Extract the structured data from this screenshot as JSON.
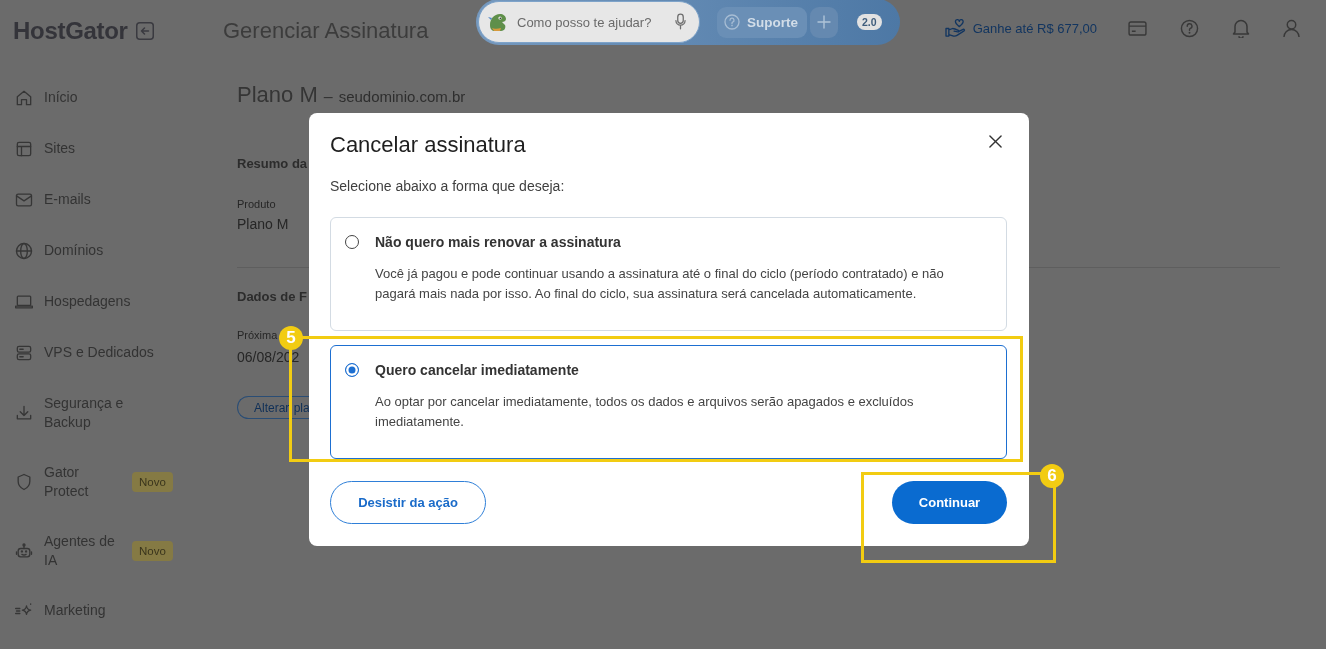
{
  "header": {
    "logo": "HostGator",
    "page_title": "Gerenciar Assinatura",
    "assistant": {
      "placeholder": "Como posso te ajudar?",
      "support_button": "Suporte",
      "version": "2.0"
    },
    "referral_link": "Ganhe até R$ 677,00"
  },
  "sidebar": {
    "items": [
      {
        "label": "Início",
        "selected": false
      },
      {
        "label": "Sites",
        "selected": false
      },
      {
        "label": "E-mails",
        "selected": false
      },
      {
        "label": "Domínios",
        "selected": false
      },
      {
        "label": "Hospedagens",
        "selected": false
      },
      {
        "label": "VPS e Dedicados",
        "selected": false
      },
      {
        "label": "Segurança e Backup",
        "selected": false
      },
      {
        "label": "Gator Protect",
        "selected": false,
        "badge": "Novo"
      },
      {
        "label": "Agentes de IA",
        "selected": false,
        "badge": "Novo"
      },
      {
        "label": "Marketing",
        "selected": false
      }
    ]
  },
  "main": {
    "title": "Plano M",
    "separator": "–",
    "domain": "seudominio.com.br",
    "sections": [
      {
        "heading": "Resumo da",
        "fields": [
          {
            "label": "Produto",
            "value": "Plano M"
          }
        ]
      },
      {
        "heading": "Dados de F",
        "fields": [
          {
            "label": "Próxima",
            "value": "06/08/202"
          }
        ],
        "button": "Alterar pla"
      }
    ]
  },
  "modal": {
    "title": "Cancelar assinatura",
    "prompt": "Selecione abaixo a forma que deseja:",
    "options": [
      {
        "title": "Não quero mais renovar a assinatura",
        "description": "Você já pagou e pode continuar usando a assinatura até o final do ciclo (período contratado) e não pagará mais nada por isso. Ao final do ciclo, sua assinatura será cancelada automaticamente.",
        "selected": false
      },
      {
        "title": "Quero cancelar imediatamente",
        "description": "Ao optar por cancelar imediatamente, todos os dados e arquivos serão apagados e excluídos imediatamente.",
        "selected": true,
        "callout": "5"
      }
    ],
    "cancel_button": "Desistir da ação",
    "confirm_button": {
      "label": "Continuar",
      "callout": "6"
    }
  }
}
